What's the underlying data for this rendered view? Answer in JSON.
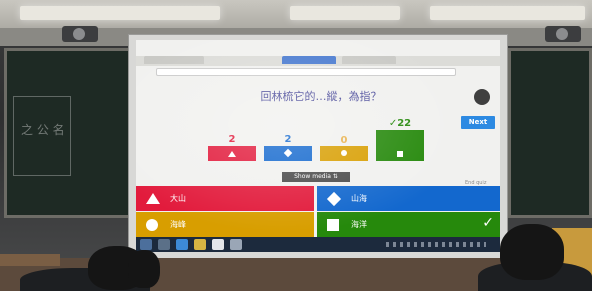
{
  "quiz": {
    "question_text": "回林梳它的…縱，為指？",
    "next_label": "Next",
    "show_media_label": "Show media ⇅",
    "end_quiz_label": "End quiz",
    "results": [
      {
        "count": "2",
        "shape": "triangle",
        "color": "#e21b3c",
        "correct": false
      },
      {
        "count": "2",
        "shape": "diamond",
        "color": "#1368ce",
        "correct": false
      },
      {
        "count": "0",
        "shape": "circle",
        "color": "#d89e00",
        "correct": false
      },
      {
        "count": "✓22",
        "shape": "square",
        "color": "#26890c",
        "correct": true
      }
    ],
    "answers": [
      {
        "text": "大山",
        "shape": "triangle",
        "color": "#e21b3c"
      },
      {
        "text": "山海",
        "shape": "diamond",
        "color": "#1368ce"
      },
      {
        "text": "海峰",
        "shape": "circle",
        "color": "#d89e00"
      },
      {
        "text": "海洋",
        "shape": "square",
        "color": "#26890c"
      }
    ],
    "correct_mark": "✓"
  },
  "colors": {
    "red": "#e21b3c",
    "blue": "#1368ce",
    "yellow": "#d89e00",
    "green": "#26890c",
    "next_button": "#2d8ae2",
    "taskbar": "#1c2a3d"
  },
  "chalkboard_text": "之 公 名"
}
